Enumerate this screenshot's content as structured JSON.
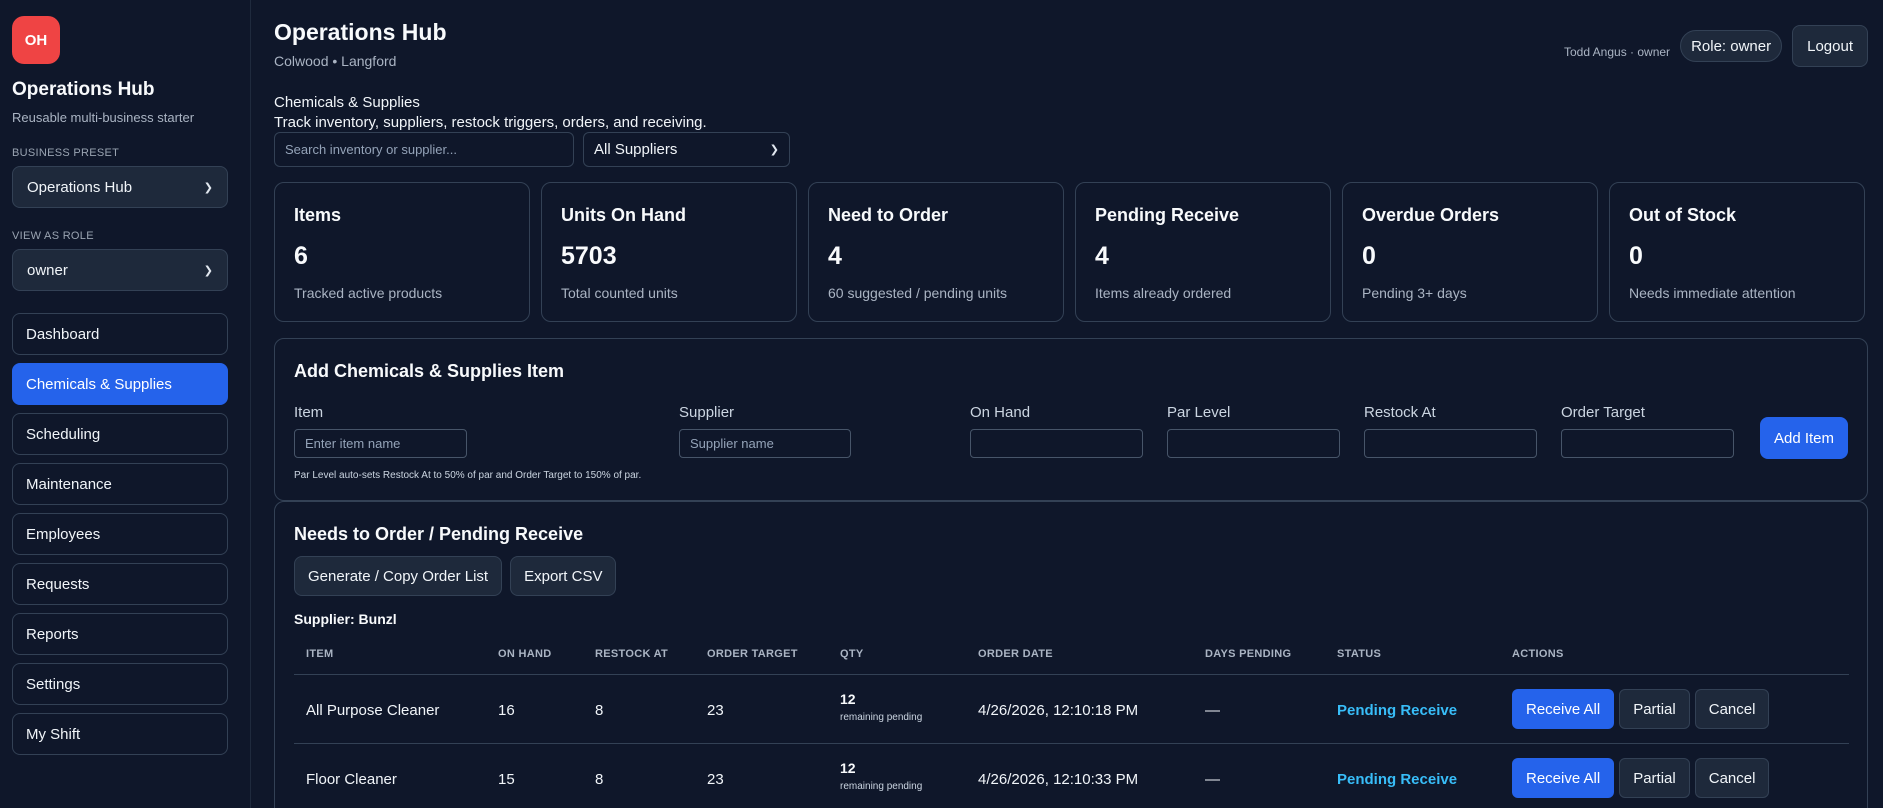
{
  "sidebar": {
    "logo_text": "OH",
    "brand_title": "Operations Hub",
    "brand_subtitle": "Reusable multi-business starter",
    "preset_label": "BUSINESS PRESET",
    "preset_value": "Operations Hub",
    "role_label": "VIEW AS ROLE",
    "role_value": "owner",
    "nav": [
      {
        "label": "Dashboard",
        "active": false
      },
      {
        "label": "Chemicals & Supplies",
        "active": true
      },
      {
        "label": "Scheduling",
        "active": false
      },
      {
        "label": "Maintenance",
        "active": false
      },
      {
        "label": "Employees",
        "active": false
      },
      {
        "label": "Requests",
        "active": false
      },
      {
        "label": "Reports",
        "active": false
      },
      {
        "label": "Settings",
        "active": false
      },
      {
        "label": "My Shift",
        "active": false
      }
    ]
  },
  "header": {
    "title": "Operations Hub",
    "location": "Colwood • Langford",
    "user": "Todd Angus · owner",
    "role_pill": "Role: owner",
    "logout": "Logout"
  },
  "section": {
    "title": "Chemicals & Supplies",
    "description": "Track inventory, suppliers, restock triggers, orders, and receiving.",
    "search_placeholder": "Search inventory or supplier...",
    "supplier_filter": "All Suppliers"
  },
  "stats": [
    {
      "title": "Items",
      "value": "6",
      "sub": "Tracked active products"
    },
    {
      "title": "Units On Hand",
      "value": "5703",
      "sub": "Total counted units"
    },
    {
      "title": "Need to Order",
      "value": "4",
      "sub": "60 suggested / pending units"
    },
    {
      "title": "Pending Receive",
      "value": "4",
      "sub": "Items already ordered"
    },
    {
      "title": "Overdue Orders",
      "value": "0",
      "sub": "Pending 3+ days"
    },
    {
      "title": "Out of Stock",
      "value": "0",
      "sub": "Needs immediate attention"
    }
  ],
  "add_item": {
    "title": "Add Chemicals & Supplies Item",
    "item_label": "Item",
    "item_placeholder": "Enter item name",
    "supplier_label": "Supplier",
    "supplier_placeholder": "Supplier name",
    "on_hand_label": "On Hand",
    "par_label": "Par Level",
    "restock_label": "Restock At",
    "target_label": "Order Target",
    "add_button": "Add Item",
    "hint": "Par Level auto-sets Restock At to 50% of par and Order Target to 150% of par."
  },
  "orders": {
    "title": "Needs to Order / Pending Receive",
    "generate_button": "Generate / Copy Order List",
    "export_button": "Export CSV",
    "supplier_heading": "Supplier: Bunzl",
    "columns": [
      "ITEM",
      "ON HAND",
      "RESTOCK AT",
      "ORDER TARGET",
      "QTY",
      "ORDER DATE",
      "DAYS PENDING",
      "STATUS",
      "ACTIONS"
    ],
    "rows": [
      {
        "item": "All Purpose Cleaner",
        "on_hand": "16",
        "restock_at": "8",
        "order_target": "23",
        "qty": "12",
        "qty_note": "remaining pending",
        "order_date": "4/26/2026, 12:10:18 PM",
        "days_pending": "—",
        "status": "Pending Receive"
      },
      {
        "item": "Floor Cleaner",
        "on_hand": "15",
        "restock_at": "8",
        "order_target": "23",
        "qty": "12",
        "qty_note": "remaining pending",
        "order_date": "4/26/2026, 12:10:33 PM",
        "days_pending": "—",
        "status": "Pending Receive"
      }
    ],
    "action_receive": "Receive All",
    "action_partial": "Partial",
    "action_cancel": "Cancel"
  },
  "colors": {
    "background": "#0f172a",
    "accent": "#2563eb",
    "logo": "#ef4444",
    "status": "#38bdf8"
  }
}
